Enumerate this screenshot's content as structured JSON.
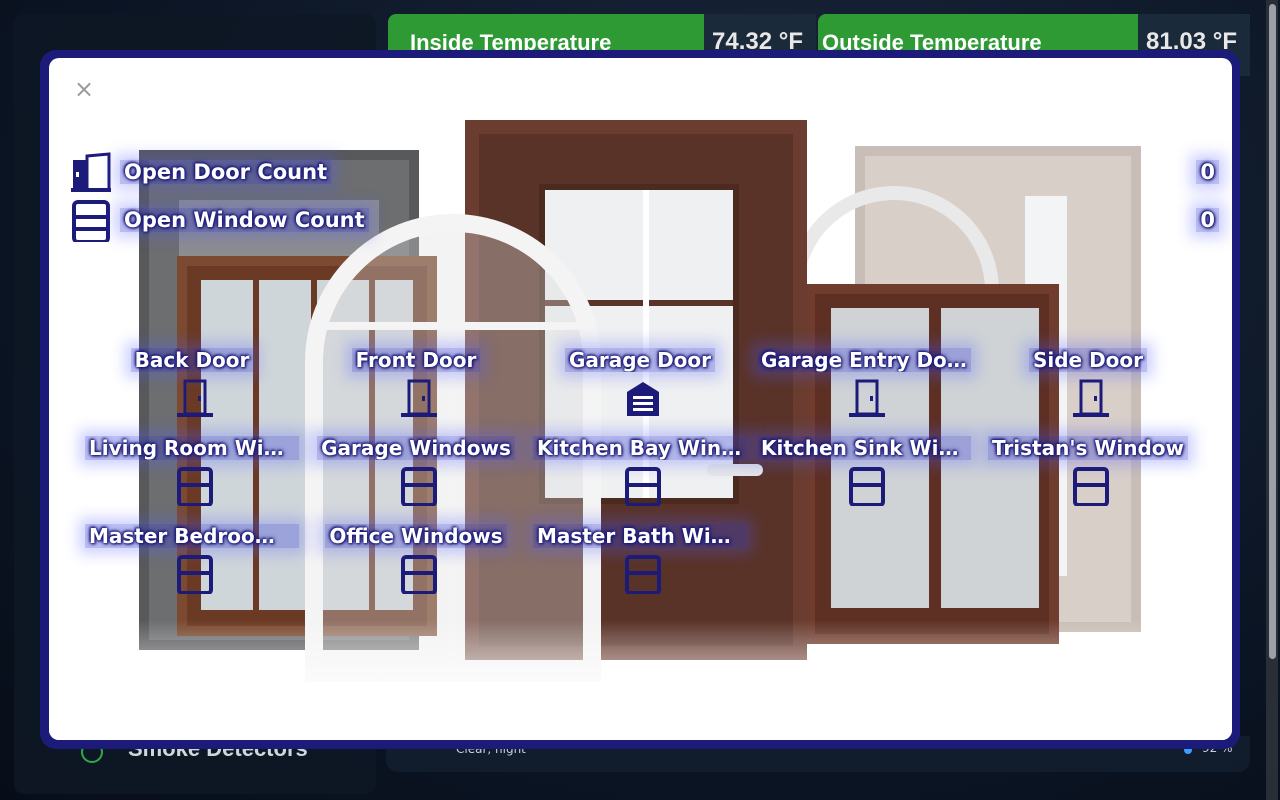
{
  "background": {
    "tiles": [
      {
        "name": "Inside Temperature",
        "value": "74.32 °F"
      },
      {
        "name": "Outside Temperature",
        "value": "81.03 °F"
      }
    ],
    "sidebar_bottom_label": "Smoke Detectors",
    "weather_condition": "Clear, night",
    "humidity": "92 %"
  },
  "modal": {
    "close_symbol": "×",
    "counts": [
      {
        "label": "Open Door Count",
        "value": "0",
        "icon": "door-open-icon"
      },
      {
        "label": "Open Window Count",
        "value": "0",
        "icon": "window-closed-icon"
      }
    ],
    "sensors": [
      {
        "name": "Back Door",
        "icon": "door-closed-icon",
        "status": "closed"
      },
      {
        "name": "Front Door",
        "icon": "door-closed-icon",
        "status": "closed"
      },
      {
        "name": "Garage Door",
        "icon": "garage-icon",
        "status": "closed"
      },
      {
        "name": "Garage Entry Door",
        "icon": "door-closed-icon",
        "status": "closed"
      },
      {
        "name": "Side Door",
        "icon": "door-closed-icon",
        "status": "closed"
      },
      {
        "name": "Living Room Wind...",
        "icon": "window-closed-icon",
        "status": "closed"
      },
      {
        "name": "Garage Windows",
        "icon": "window-closed-icon",
        "status": "closed"
      },
      {
        "name": "Kitchen Bay Wind...",
        "icon": "window-closed-icon",
        "status": "closed"
      },
      {
        "name": "Kitchen Sink Wind...",
        "icon": "window-closed-icon",
        "status": "closed"
      },
      {
        "name": "Tristan's Window",
        "icon": "window-closed-icon",
        "status": "closed"
      },
      {
        "name": "Master Bedroom ...",
        "icon": "window-closed-icon",
        "status": "closed"
      },
      {
        "name": "Office Windows",
        "icon": "window-closed-icon",
        "status": "closed"
      },
      {
        "name": "Master Bath Win...",
        "icon": "window-closed-icon",
        "status": "closed"
      }
    ]
  },
  "colors": {
    "accent": "#1c1b7a",
    "tile_green": "#2d9a34",
    "text_on_glow": "#ffffff"
  }
}
